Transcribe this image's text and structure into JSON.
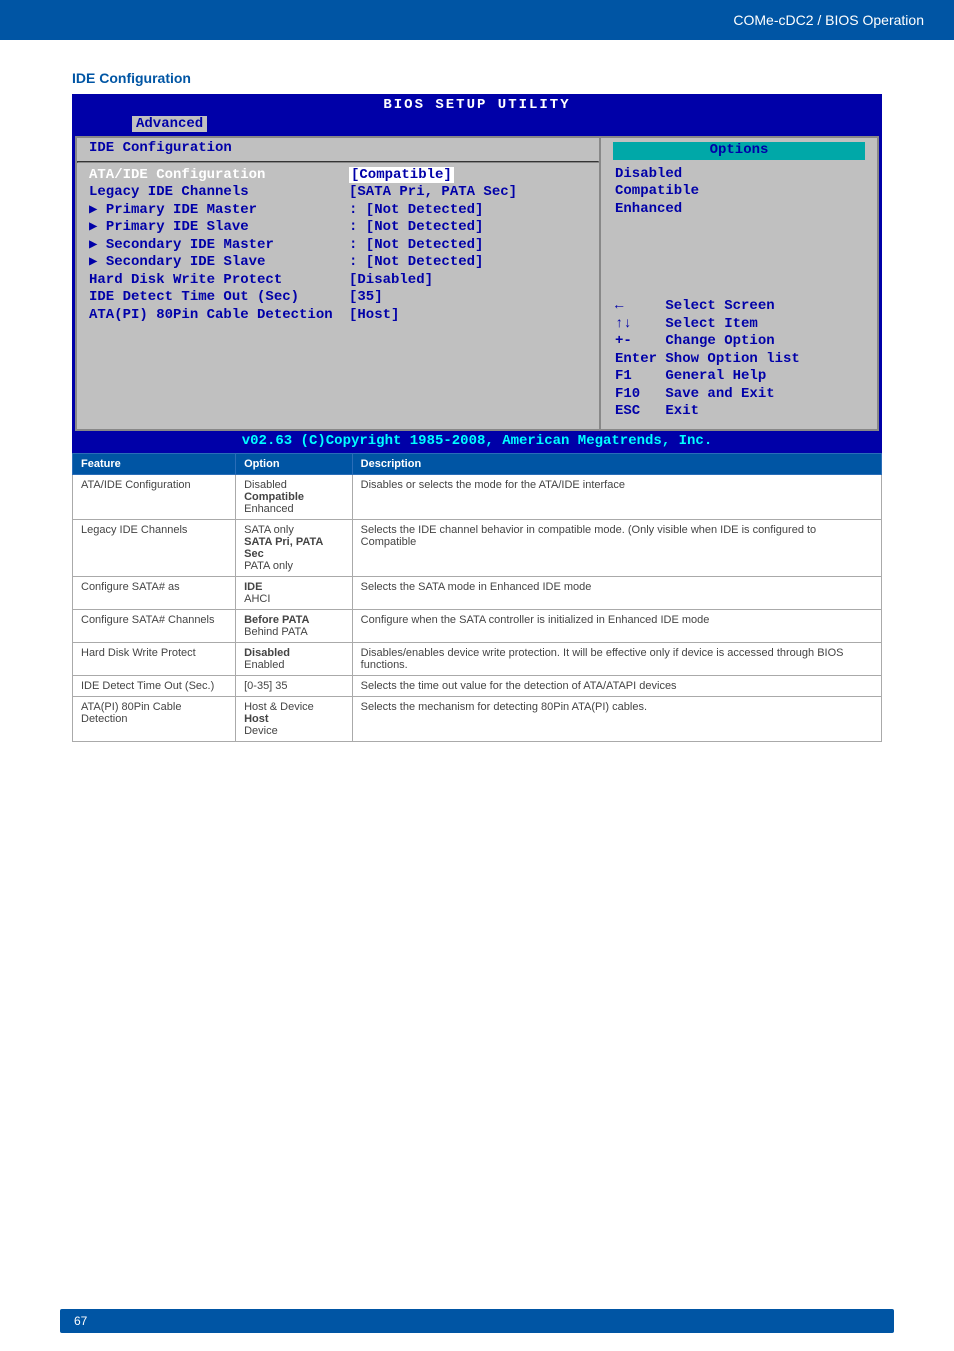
{
  "header": {
    "breadcrumb": "COMe-cDC2 / BIOS Operation"
  },
  "section": {
    "title": "IDE Configuration"
  },
  "bios": {
    "title": "BIOS SETUP UTILITY",
    "tab": "Advanced",
    "panel_title": "IDE Configuration",
    "items": [
      {
        "label": "ATA/IDE Configuration",
        "value": "[Compatible]",
        "selected": true
      },
      {
        "label": "  Legacy IDE Channels",
        "value": "[SATA Pri, PATA Sec]"
      },
      {
        "label": "",
        "value": ""
      },
      {
        "label": "▶ Primary IDE Master",
        "value": ": [Not Detected]"
      },
      {
        "label": "▶ Primary IDE Slave",
        "value": ": [Not Detected]"
      },
      {
        "label": "▶ Secondary IDE Master",
        "value": ": [Not Detected]"
      },
      {
        "label": "▶ Secondary IDE Slave",
        "value": ": [Not Detected]"
      },
      {
        "label": "",
        "value": ""
      },
      {
        "label": "Hard Disk Write Protect",
        "value": "[Disabled]"
      },
      {
        "label": "IDE Detect Time Out (Sec)",
        "value": "[35]"
      },
      {
        "label": "ATA(PI) 80Pin Cable Detection",
        "value": "[Host]"
      }
    ],
    "options_title": "Options",
    "options": [
      "Disabled",
      "Compatible",
      "Enhanced"
    ],
    "help": [
      "←     Select Screen",
      "↑↓    Select Item",
      "+-    Change Option",
      "Enter Show Option list",
      "F1    General Help",
      "F10   Save and Exit",
      "ESC   Exit"
    ],
    "copyright": "v02.63 (C)Copyright 1985-2008, American Megatrends, Inc."
  },
  "table": {
    "headers": [
      "Feature",
      "Option",
      "Description"
    ],
    "rows": [
      {
        "feature": "ATA/IDE Configuration",
        "options": [
          "Disabled",
          "Compatible",
          "Enhanced"
        ],
        "default": "Compatible",
        "description": "Disables or selects the mode for the ATA/IDE interface"
      },
      {
        "feature": "Legacy IDE Channels",
        "options": [
          "SATA only",
          "SATA Pri, PATA Sec",
          "PATA only"
        ],
        "default": "SATA Pri, PATA Sec",
        "description": "Selects the IDE channel behavior in compatible mode. (Only visible when IDE is configured to Compatible"
      },
      {
        "feature": "Configure SATA# as",
        "options": [
          "IDE",
          "AHCI"
        ],
        "default": "IDE",
        "description": "Selects the SATA mode in Enhanced IDE mode"
      },
      {
        "feature": "Configure SATA# Channels",
        "options": [
          "Before PATA",
          "Behind PATA"
        ],
        "default": "Before PATA",
        "description": "Configure when the SATA controller is initialized in Enhanced IDE mode"
      },
      {
        "feature": "Hard Disk Write Protect",
        "options": [
          "Disabled",
          "Enabled"
        ],
        "default": "Disabled",
        "description": "Disables/enables device write protection. It will be effective only if device is accessed through BIOS functions."
      },
      {
        "feature": "IDE Detect Time Out (Sec.)",
        "options": [
          "[0-35] 35"
        ],
        "default": "",
        "description": "Selects the time out value for the detection of ATA/ATAPI devices"
      },
      {
        "feature": "ATA(PI) 80Pin Cable Detection",
        "options": [
          "Host & Device",
          "Host",
          "Device"
        ],
        "default": "Host",
        "description": "Selects the mechanism for detecting 80Pin ATA(PI) cables."
      }
    ]
  },
  "page": "67"
}
